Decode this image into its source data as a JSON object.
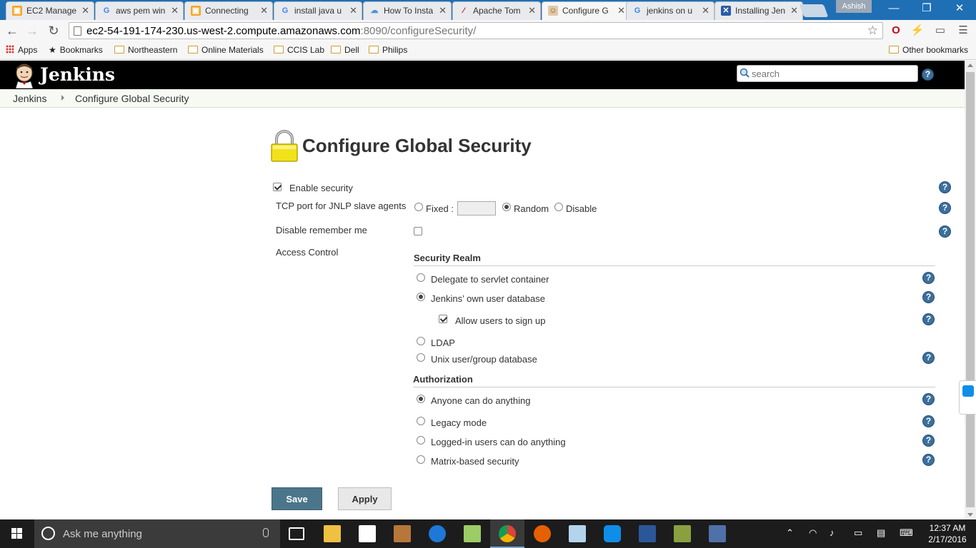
{
  "browser": {
    "tabs": [
      {
        "title": "EC2 Manage",
        "icon": "aws-box-icon",
        "color": "#f5a623"
      },
      {
        "title": "aws pem win",
        "icon": "google-icon",
        "color": "#4285f4"
      },
      {
        "title": "Connecting",
        "icon": "aws-box-icon",
        "color": "#f5a623"
      },
      {
        "title": "install java u",
        "icon": "google-icon",
        "color": "#4285f4"
      },
      {
        "title": "How To Insta",
        "icon": "cloud-icon",
        "color": "#4a90d9"
      },
      {
        "title": "Apache Tom",
        "icon": "feather-icon",
        "color": "#d0021b"
      },
      {
        "title": "Configure G",
        "icon": "jenkins-icon",
        "color": "#8b5a2b"
      },
      {
        "title": "jenkins on u",
        "icon": "google-icon",
        "color": "#4285f4"
      },
      {
        "title": "Installing Jen",
        "icon": "x-icon",
        "color": "#2a5caa"
      }
    ],
    "profile_name": "Ashish",
    "url_host": "ec2-54-191-174-230.us-west-2.compute.amazonaws.com",
    "url_path": ":8090/configureSecurity/",
    "bookmarks": [
      "Apps",
      "Bookmarks",
      "Northeastern",
      "Online Materials",
      "CCIS Lab",
      "Dell",
      "Philips"
    ],
    "other_bookmarks": "Other bookmarks"
  },
  "jenkins": {
    "title": "Jenkins",
    "search_placeholder": "search",
    "breadcrumbs": [
      "Jenkins",
      "Configure Global Security"
    ]
  },
  "page": {
    "title": "Configure Global Security",
    "enable_security": {
      "label": "Enable security",
      "checked": true
    },
    "jnlp": {
      "label": "TCP port for JNLP slave agents",
      "fixed_label": "Fixed :",
      "fixed_value": "",
      "random_label": "Random",
      "disable_label": "Disable",
      "selected": "Random"
    },
    "remember_me": {
      "label": "Disable remember me",
      "checked": false
    },
    "access_control_label": "Access Control",
    "security_realm": {
      "heading": "Security Realm",
      "options": [
        {
          "label": "Delegate to servlet container",
          "checked": false,
          "help": true
        },
        {
          "label": "Jenkins’ own user database",
          "checked": true,
          "help": true
        },
        {
          "label": "LDAP",
          "checked": false,
          "help": false
        },
        {
          "label": "Unix user/group database",
          "checked": false,
          "help": true
        }
      ],
      "allow_signup": {
        "label": "Allow users to sign up",
        "checked": true
      }
    },
    "authorization": {
      "heading": "Authorization",
      "options": [
        {
          "label": "Anyone can do anything",
          "checked": true
        },
        {
          "label": "Legacy mode",
          "checked": false
        },
        {
          "label": "Logged-in users can do anything",
          "checked": false
        },
        {
          "label": "Matrix-based security",
          "checked": false
        }
      ]
    },
    "save_label": "Save",
    "apply_label": "Apply"
  },
  "taskbar": {
    "search_text": "Ask me anything",
    "time": "12:37 AM",
    "date": "2/17/2016"
  },
  "colors": {
    "chrome_frame": "#1f6fb5",
    "jenkins_header": "#000000",
    "save_button": "#4b758b",
    "help_icon": "#3c6f9c"
  }
}
